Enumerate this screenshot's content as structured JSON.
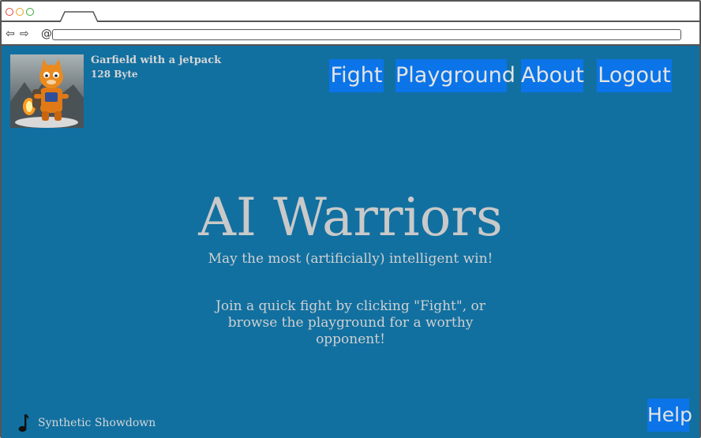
{
  "browser": {
    "tab_title": "",
    "url": ""
  },
  "user": {
    "name": "Garfield with a jetpack",
    "subtitle": "128 Byte",
    "avatar_icon": "garfield-jetpack-avatar"
  },
  "nav": {
    "items": [
      {
        "label": "Fight"
      },
      {
        "label": "Playground"
      },
      {
        "label": "About"
      },
      {
        "label": "Logout"
      }
    ]
  },
  "hero": {
    "title": "AI Warriors",
    "tagline": "May the most (artificially) intelligent win!",
    "intro": "Join a quick fight by clicking \"Fight\", or browse the playground for a worthy opponent!"
  },
  "footer": {
    "music_icon": "music-note-icon",
    "music_label": "Synthetic Showdown",
    "help_label": "Help"
  },
  "colors": {
    "page_background": "#1170a0",
    "button_background": "#0a74e8",
    "text": "#d0d0d0"
  }
}
